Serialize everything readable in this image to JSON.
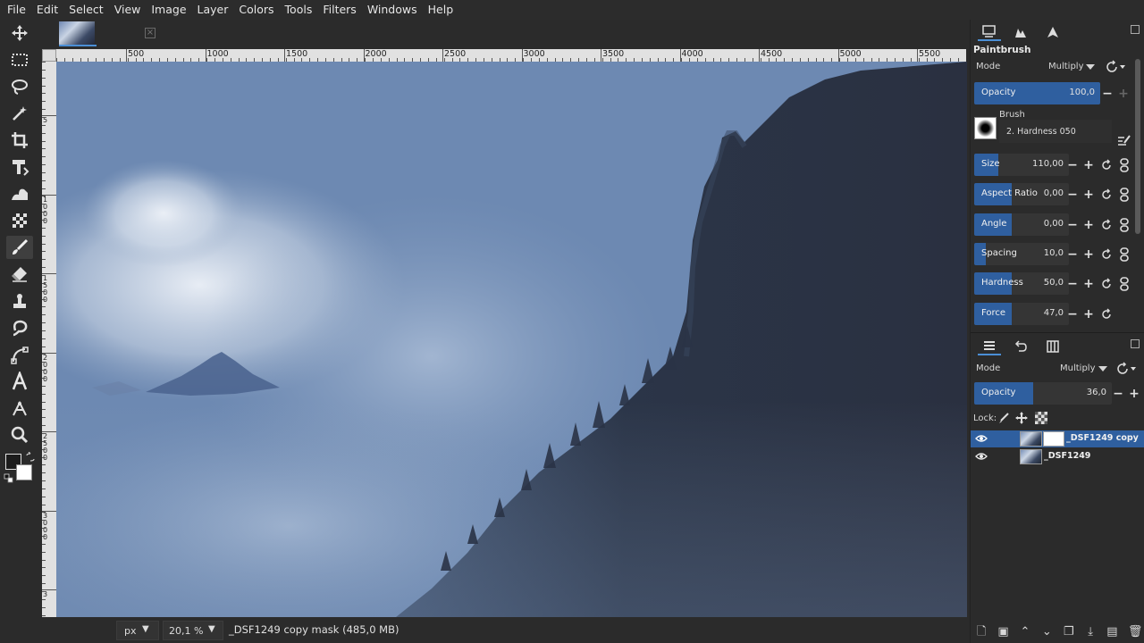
{
  "menubar": {
    "items": [
      "File",
      "Edit",
      "Select",
      "View",
      "Image",
      "Layer",
      "Colors",
      "Tools",
      "Filters",
      "Windows",
      "Help"
    ]
  },
  "toolbox": {
    "tools": [
      "move-tool-icon",
      "rect-select-icon",
      "lasso-icon",
      "fuzzy-select-icon",
      "crop-icon",
      "unified-transform-icon",
      "warp-icon",
      "fill-icon",
      "paintbrush-icon",
      "eraser-icon",
      "clone-icon",
      "smudge-icon",
      "paths-icon",
      "text-icon",
      "color-picker-icon",
      "zoom-icon"
    ],
    "active": "paintbrush-icon",
    "fg_color": "#1c1c1c",
    "bg_color": "#ffffff"
  },
  "ruler": {
    "h_labels": [
      "500",
      "1000",
      "1500",
      "2000",
      "2500",
      "3000",
      "3500",
      "4000",
      "4500",
      "5000",
      "5500"
    ],
    "v_labels": [
      "5",
      "1 0 0 0",
      "1 5 0 0",
      "2 0 0 0",
      "2 5 0 0",
      "3 0 0 0",
      "3"
    ]
  },
  "statusbar": {
    "unit": "px",
    "zoom": "20,1 %",
    "info": "_DSF1249 copy mask (485,0 MB)"
  },
  "tool_options": {
    "title": "Paintbrush",
    "mode_label": "Mode",
    "mode_value": "Multiply",
    "opacity": {
      "label": "Opacity",
      "value": "100,0",
      "fraction": 1.0
    },
    "brush_label": "Brush",
    "brush_name": "2. Hardness 050",
    "sliders": [
      {
        "label": "Size",
        "value": "110,00",
        "fraction": 0.25
      },
      {
        "label": "Aspect Ratio",
        "value": "0,00",
        "fraction": 0.4
      },
      {
        "label": "Angle",
        "value": "0,00",
        "fraction": 0.4
      },
      {
        "label": "Spacing",
        "value": "10,0",
        "fraction": 0.12
      },
      {
        "label": "Hardness",
        "value": "50,0",
        "fraction": 0.4
      },
      {
        "label": "Force",
        "value": "47,0",
        "fraction": 0.4
      }
    ]
  },
  "layers": {
    "mode_label": "Mode",
    "mode_value": "Multiply",
    "opacity": {
      "label": "Opacity",
      "value": "36,0",
      "fraction": 0.43
    },
    "lock_label": "Lock:",
    "items": [
      {
        "name": "_DSF1249 copy",
        "selected": true,
        "has_mask": true
      },
      {
        "name": "_DSF1249",
        "selected": false,
        "has_mask": false
      }
    ]
  },
  "colors": {
    "accent": "#2f5f9f",
    "tab_indicator": "#4b8fd6"
  }
}
